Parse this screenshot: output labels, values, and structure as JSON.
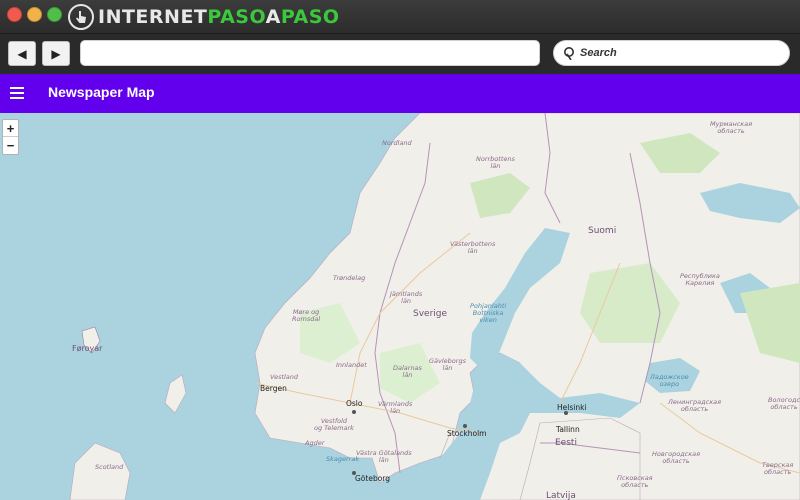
{
  "brand": {
    "logo_part1": "INTERNET",
    "logo_part2": "PASO",
    "logo_part3": "A",
    "logo_part4": "PASO"
  },
  "toolbar": {
    "back_symbol": "◀",
    "forward_symbol": "▶",
    "url_value": "",
    "search_placeholder": "Search"
  },
  "app": {
    "title": "Newspaper Map",
    "accent_color": "#6200ee"
  },
  "map": {
    "zoom_in": "+",
    "zoom_out": "−",
    "labels": {
      "murmansk": "Мурманская\nобласть",
      "nordland": "Nordland",
      "norrbotten": "Norrbottens\nlän",
      "suomi": "Suomi",
      "vasterbotten": "Västerbottens\nlän",
      "karelia": "Республика\nКарелия",
      "trondelag": "Trøndelag",
      "jamtland": "Jämtlands\nlän",
      "more": "Møre og\nRomsdal",
      "sverige": "Sverige",
      "bothnia": "Pohjanlahti\nBottniska\nviken",
      "faroe": "Føroyar",
      "innlandet": "Innlandet",
      "dalarnas": "Dalarnas\nlän",
      "gavleborg": "Gävleborgs\nlän",
      "bergen": "Bergen",
      "vestland": "Vestland",
      "oslo": "Oslo",
      "varmland": "Värmlands\nlän",
      "helsinki": "Helsinki",
      "leningrad": "Ленинградская\nобласть",
      "vologda": "Вологодс\nобласть",
      "vestfold": "Vestfold\nog Telemark",
      "agder": "Agder",
      "stockholm": "Stockholm",
      "tallinn": "Tallinn",
      "eesti": "Eesti",
      "vastra": "Västra Götalands\nlän",
      "skagerrak": "Skagerrak",
      "scotland": "Scotland",
      "novgorod": "Новгородская\nобласть",
      "goteborg": "Göteborg",
      "latvija": "Latvija",
      "pskov": "Псковская\nобласть",
      "tver": "Тверская\nобласть",
      "ladoga": "Ладожское\nозеро"
    }
  }
}
